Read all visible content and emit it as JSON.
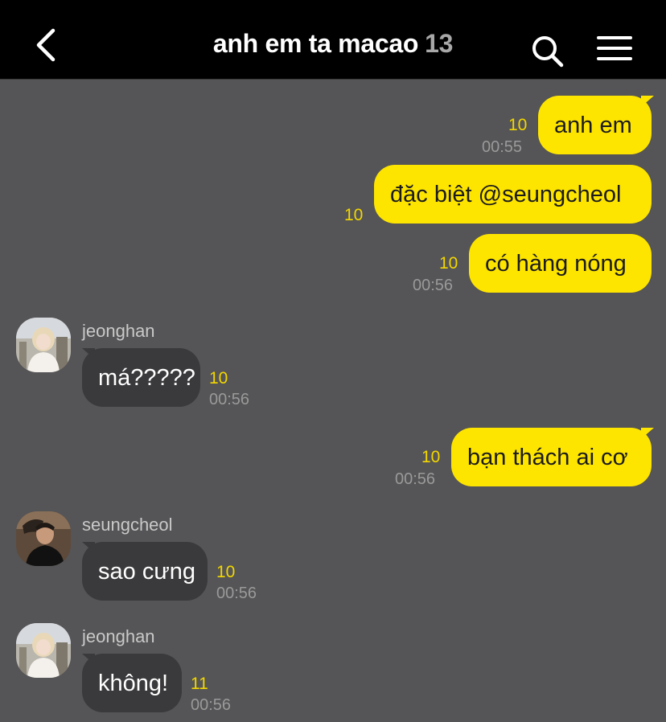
{
  "header": {
    "title": "anh em ta macao",
    "member_count": "13"
  },
  "colors": {
    "header_bg": "#000000",
    "chat_bg": "#555456",
    "my_bubble": "#fee500",
    "other_bubble": "#3a393b",
    "unread_count": "#f2d700"
  },
  "messages": [
    {
      "text": "anh em",
      "unread": "10",
      "time": "00:55"
    },
    {
      "text": "đặc biệt @seungcheol",
      "unread": "10"
    },
    {
      "text": "có hàng nóng",
      "unread": "10",
      "time": "00:56"
    },
    {
      "sender": "jeonghan",
      "text": "má?????",
      "unread": "10",
      "time": "00:56",
      "avatar": "jeonghan-avatar"
    },
    {
      "text": "bạn thách ai cơ",
      "unread": "10",
      "time": "00:56"
    },
    {
      "sender": "seungcheol",
      "text": "sao cưng",
      "unread": "10",
      "time": "00:56",
      "avatar": "seungcheol-avatar"
    },
    {
      "sender": "jeonghan",
      "text": "không!",
      "unread": "11",
      "time": "00:56",
      "avatar": "jeonghan-avatar"
    }
  ],
  "icons": {
    "back": "chevron-left-icon",
    "search": "search-icon",
    "menu": "hamburger-menu-icon"
  }
}
